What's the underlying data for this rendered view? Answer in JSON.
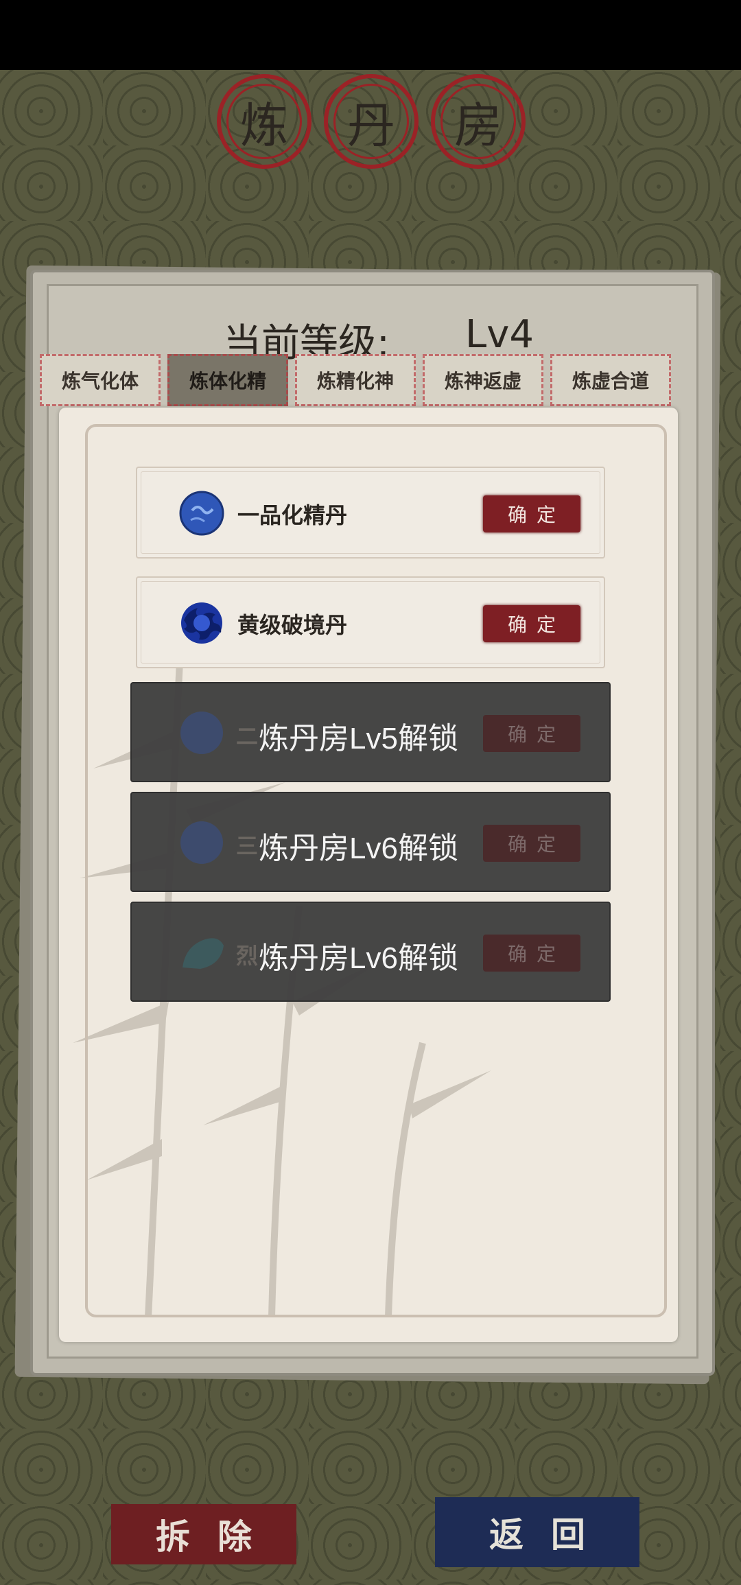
{
  "header": {
    "seal_chars": [
      "炼",
      "丹",
      "房"
    ]
  },
  "level": {
    "label": "当前等级:",
    "value": "Lv4"
  },
  "tabs": [
    {
      "label": "炼气化体",
      "active": false
    },
    {
      "label": "炼体化精",
      "active": true
    },
    {
      "label": "炼精化神",
      "active": false
    },
    {
      "label": "炼神返虚",
      "active": false
    },
    {
      "label": "炼虚合道",
      "active": false
    }
  ],
  "recipes": [
    {
      "name": "一品化精丹",
      "button": "确定",
      "icon": "blue-pill-icon"
    },
    {
      "name": "黄级破境丹",
      "button": "确定",
      "icon": "dark-blue-pill-icon"
    }
  ],
  "locked": [
    {
      "prefix": "二",
      "message": "炼丹房Lv5解锁",
      "button": "确定",
      "icon": "blue-pill-icon"
    },
    {
      "prefix": "三",
      "message": "炼丹房Lv6解锁",
      "button": "确定",
      "icon": "blue-pill-icon"
    },
    {
      "prefix": "烈",
      "message": "炼丹房Lv6解锁",
      "button": "确定",
      "icon": "teal-shell-icon"
    }
  ],
  "footer": {
    "demolish_label": "拆除",
    "return_label": "返回"
  },
  "colors": {
    "seal_red": "#9b2226",
    "confirm_red": "#7e1f24",
    "return_blue": "#1e2c55",
    "background": "#58593f"
  }
}
